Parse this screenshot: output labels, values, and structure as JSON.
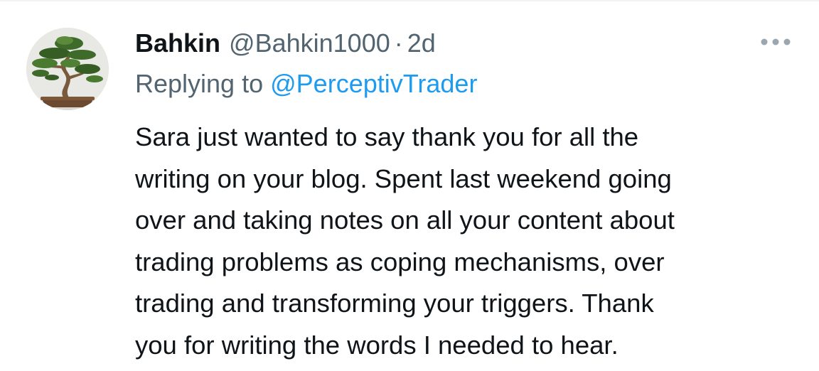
{
  "tweet": {
    "author": {
      "display_name": "Bahkin",
      "handle": "@Bahkin1000",
      "avatar_icon": "bonsai-tree-avatar"
    },
    "separator": "·",
    "timestamp": "2d",
    "reply": {
      "prefix": "Replying to",
      "target": "@PerceptivTrader"
    },
    "text": "Sara just wanted to say thank you for all the\nwriting on your blog. Spent last weekend going\nover and taking notes on all your content about\ntrading problems as coping mechanisms, over\ntrading and transforming your triggers. Thank\nyou for writing the words I needed to hear.",
    "more_icon": "more-horizontal-icon"
  },
  "colors": {
    "primary_text": "#0f1419",
    "secondary_text": "#536471",
    "link": "#1d9bf0",
    "divider": "#eff3f4"
  }
}
